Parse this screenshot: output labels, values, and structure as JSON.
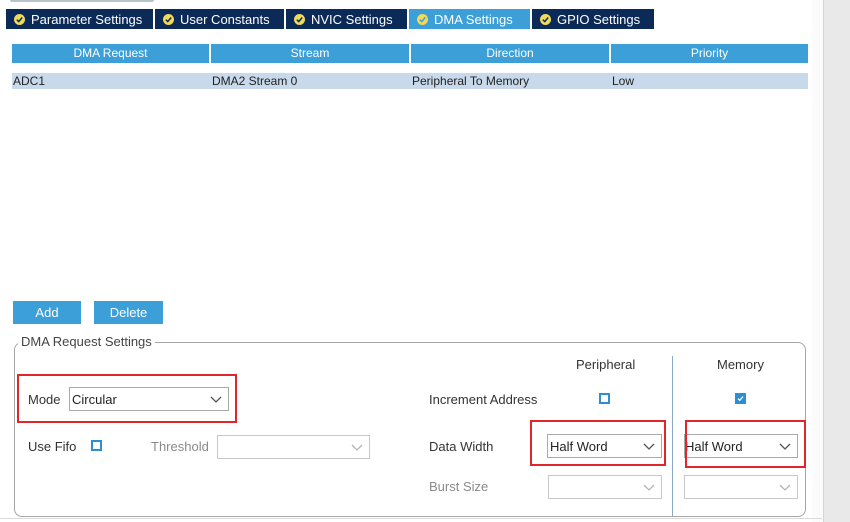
{
  "tabs": [
    {
      "label": "Parameter Settings",
      "icon": "check-circle-icon"
    },
    {
      "label": "User Constants",
      "icon": "check-circle-icon"
    },
    {
      "label": "NVIC Settings",
      "icon": "check-circle-icon"
    },
    {
      "label": "DMA Settings",
      "icon": "check-circle-icon",
      "active": true
    },
    {
      "label": "GPIO Settings",
      "icon": "check-circle-icon"
    }
  ],
  "table": {
    "columns": [
      "DMA Request",
      "Stream",
      "Direction",
      "Priority"
    ],
    "rows": [
      [
        "ADC1",
        "DMA2 Stream 0",
        "Peripheral To Memory",
        "Low"
      ]
    ]
  },
  "buttons": {
    "add": "Add",
    "delete": "Delete"
  },
  "dma_request_settings": {
    "legend": "DMA Request Settings",
    "peripheral_header": "Peripheral",
    "memory_header": "Memory",
    "mode_label": "Mode",
    "mode_value": "Circular",
    "use_fifo_label": "Use Fifo",
    "use_fifo_checked": false,
    "threshold_label": "Threshold",
    "threshold_value": "",
    "increment_address_label": "Increment Address",
    "increment_peripheral_checked": false,
    "increment_memory_checked": true,
    "data_width_label": "Data Width",
    "data_width_peripheral": "Half Word",
    "data_width_memory": "Half Word",
    "burst_size_label": "Burst Size",
    "burst_size_peripheral": "",
    "burst_size_memory": ""
  },
  "colors": {
    "tab_bg": "#0b2a57",
    "tab_active_bg": "#3c9fd7",
    "header_bg": "#3c9fd7",
    "row_selected_bg": "#c7d9ea",
    "highlight_box": "#e0262b"
  }
}
